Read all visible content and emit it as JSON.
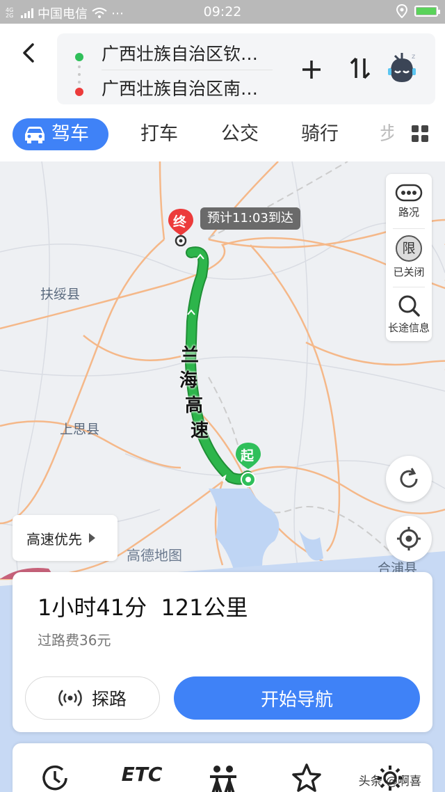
{
  "status_bar": {
    "network_badge": "4G 2G",
    "carrier": "中国电信",
    "more": "⋯",
    "time": "09:22"
  },
  "route": {
    "from": "广西壮族自治区钦…",
    "to": "广西壮族自治区南…"
  },
  "tabs": [
    {
      "label": "驾车",
      "active": true
    },
    {
      "label": "打车"
    },
    {
      "label": "公交"
    },
    {
      "label": "骑行"
    },
    {
      "label": "步"
    }
  ],
  "map": {
    "labels": {
      "fusui": "扶绥县",
      "shangsi": "上思县",
      "hepu": "合浦县"
    },
    "road_name": [
      "兰",
      "海",
      "高",
      "速"
    ],
    "end_marker": "终",
    "start_marker": "起",
    "eta": "预计11:03到达",
    "watermark": "高德地图",
    "route_color": "#2db54b",
    "road_color": "#f5b889"
  },
  "side_panel": {
    "traffic": "路况",
    "restriction_icon": "限",
    "restriction": "已关闭",
    "long_trip": "长途信息"
  },
  "preference": {
    "label": "高速优先"
  },
  "summary": {
    "duration": "1小时41分",
    "distance": "121公里",
    "toll": "过路费36元",
    "explore_label": "探路",
    "start_nav_label": "开始导航"
  },
  "bottom_bar": {
    "etc": "ETC",
    "watermark": "头条 @啊喜"
  },
  "colors": {
    "accent": "#3f82f7",
    "start_green": "#2fbf5a",
    "end_red": "#ec3b3b"
  }
}
